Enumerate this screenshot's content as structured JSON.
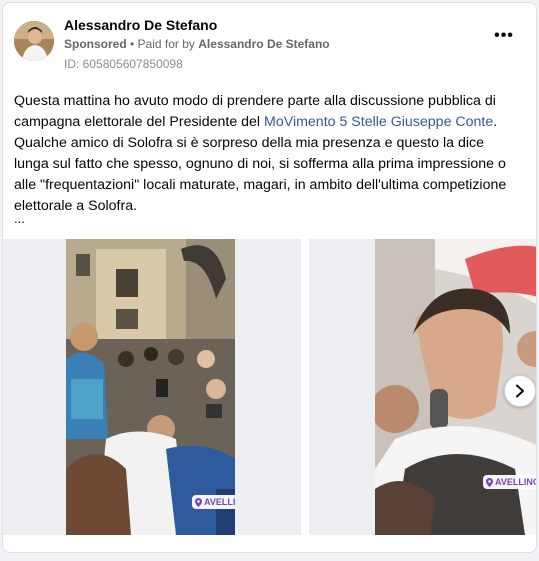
{
  "post": {
    "author": "Alessandro De Stefano",
    "sponsored": "Sponsored",
    "paid_for_prefix": "• Paid for by",
    "paid_for_name": "Alessandro De Stefano",
    "ad_id": "ID: 605805607850098",
    "more_label": "•••",
    "text_part1": "Questa mattina ho avuto modo di prendere parte alla discussione pubblica di campagna elettorale del Presidente del ",
    "text_link": "MoVimento 5 Stelle Giuseppe Conte",
    "text_part2": ". Qualche amico di Solofra si è sorpreso della mia presenza e questo la dice lunga sul fatto che spesso, ognuno di noi, si sofferma alla prima impressione o alle \"frequentazioni\" locali maturate, magari, in ambito dell'ultima competizione elettorale a Solofra.",
    "ellipsis": "..."
  },
  "media": {
    "slide1_tag": "AVELLINO",
    "slide2_tag": "AVELLINO",
    "next_icon": "chevron-right-icon"
  },
  "colors": {
    "link": "#385898",
    "tag_text": "#7b3fb8",
    "secondary_text": "#65676b"
  }
}
